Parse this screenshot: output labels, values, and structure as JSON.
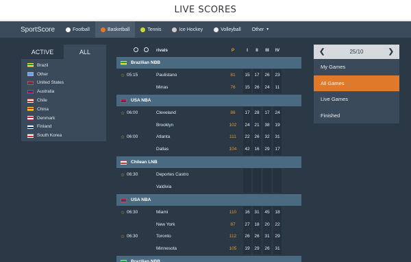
{
  "page_title": "LIVE SCORES",
  "nav": {
    "brand": "SportScore",
    "items": [
      {
        "label": "Football",
        "icon": "football-icon",
        "color": "#ffffff"
      },
      {
        "label": "Basketball",
        "icon": "basketball-icon",
        "color": "#e0792a"
      },
      {
        "label": "Tennis",
        "icon": "tennis-icon",
        "color": "#c9d93a"
      },
      {
        "label": "Ice Hockey",
        "icon": "hockey-icon",
        "color": "#cccccc"
      },
      {
        "label": "Volleyball",
        "icon": "volleyball-icon",
        "color": "#eeeeee"
      },
      {
        "label": "Other",
        "icon": "",
        "color": ""
      }
    ],
    "active_index": 1
  },
  "left": {
    "tabs": [
      "ACTIVE",
      "ALL"
    ],
    "countries": [
      {
        "name": "Brazil",
        "flag": [
          "#1f9b3f",
          "#f2d13a"
        ]
      },
      {
        "name": "Other",
        "flag": [
          "#6fa1d6",
          "#6fa1d6"
        ]
      },
      {
        "name": "United States",
        "flag": [
          "#b22234",
          "#3c3b6e"
        ]
      },
      {
        "name": "Australia",
        "flag": [
          "#1a3a8a",
          "#c8102e"
        ]
      },
      {
        "name": "Chile",
        "flag": [
          "#ffffff",
          "#d52b1e"
        ]
      },
      {
        "name": "China",
        "flag": [
          "#de2910",
          "#ffde00"
        ]
      },
      {
        "name": "Denmark",
        "flag": [
          "#c8102e",
          "#ffffff"
        ]
      },
      {
        "name": "Finland",
        "flag": [
          "#ffffff",
          "#003580"
        ]
      },
      {
        "name": "South Korea",
        "flag": [
          "#ffffff",
          "#cd2e3a"
        ]
      }
    ]
  },
  "table": {
    "headers": {
      "rivals": "rivals",
      "p": "P",
      "q1": "I",
      "q2": "II",
      "q3": "III",
      "q4": "IV"
    },
    "leagues": [
      {
        "name": "Brazilian NBB",
        "flag": [
          "#1f9b3f",
          "#f2d13a"
        ],
        "matches": [
          {
            "time": "05:15",
            "home": "Paulistano",
            "away": "Minas",
            "home_p": "81",
            "away_p": "76",
            "home_q": [
              "15",
              "17",
              "26",
              "23"
            ],
            "away_q": [
              "15",
              "26",
              "24",
              "11"
            ]
          }
        ]
      },
      {
        "name": "USA NBA",
        "flag": [
          "#b22234",
          "#3c3b6e"
        ],
        "matches": [
          {
            "time": "06:00",
            "home": "Cleveland",
            "away": "Brooklyn",
            "home_p": "86",
            "away_p": "102",
            "home_q": [
              "17",
              "28",
              "17",
              "24"
            ],
            "away_q": [
              "24",
              "21",
              "38",
              "19"
            ]
          },
          {
            "time": "06:00",
            "home": "Atlanta",
            "away": "Dallas",
            "home_p": "111",
            "away_p": "104",
            "home_q": [
              "22",
              "26",
              "32",
              "31"
            ],
            "away_q": [
              "42",
              "16",
              "29",
              "17"
            ]
          }
        ]
      },
      {
        "name": "Chilean LNB",
        "flag": [
          "#ffffff",
          "#d52b1e"
        ],
        "matches": [
          {
            "time": "06:30",
            "home": "Deportes Castro",
            "away": "Valdivia",
            "home_p": "",
            "away_p": "",
            "home_q": [
              "",
              "",
              "",
              ""
            ],
            "away_q": [
              "",
              "",
              "",
              ""
            ]
          }
        ]
      },
      {
        "name": "USA NBA",
        "flag": [
          "#b22234",
          "#3c3b6e"
        ],
        "matches": [
          {
            "time": "06:30",
            "home": "Miami",
            "away": "New York",
            "home_p": "110",
            "away_p": "87",
            "home_q": [
              "16",
              "31",
              "45",
              "18"
            ],
            "away_q": [
              "27",
              "18",
              "20",
              "22"
            ]
          },
          {
            "time": "06:30",
            "home": "Toronto",
            "away": "Minnesota",
            "home_p": "112",
            "away_p": "105",
            "home_q": [
              "26",
              "26",
              "31",
              "29"
            ],
            "away_q": [
              "19",
              "29",
              "26",
              "31"
            ]
          }
        ]
      },
      {
        "name": "Brazilian NBB",
        "flag": [
          "#1f9b3f",
          "#f2d13a"
        ],
        "matches": []
      }
    ]
  },
  "right": {
    "date": "25/10",
    "menu": [
      "My Games",
      "All Games",
      "Live Games",
      "Finished"
    ],
    "active_index": 1
  },
  "colors": {
    "accent": "#e0792a",
    "score": "#e39a2b",
    "league_bar": "#4a6a82",
    "bg": "#2b3846"
  }
}
